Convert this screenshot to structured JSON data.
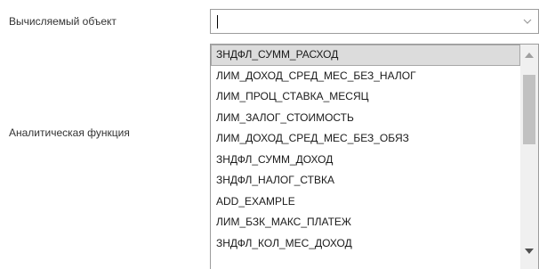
{
  "form": {
    "object_label": "Вычисляемый объект",
    "function_label": "Аналитическая функция",
    "object_value": ""
  },
  "dropdown": {
    "items": [
      "ЗНДФЛ_СУММ_РАСХОД",
      "ЛИМ_ДОХОД_СРЕД_МЕС_БЕЗ_НАЛОГ",
      "ЛИМ_ПРОЦ_СТАВКА_МЕСЯЦ",
      "ЛИМ_ЗАЛОГ_СТОИМОСТЬ",
      "ЛИМ_ДОХОД_СРЕД_МЕС_БЕЗ_ОБЯЗ",
      "ЗНДФЛ_СУММ_ДОХОД",
      "ЗНДФЛ_НАЛОГ_СТВКА",
      "ADD_EXAMPLE",
      "ЛИМ_БЗК_МАКС_ПЛАТЕЖ",
      "ЗНДФЛ_КОЛ_МЕС_ДОХОД"
    ],
    "selected_index": 0
  },
  "icons": {
    "combo_arrow": "chevron-down-icon",
    "scroll_up": "triangle-up-icon",
    "scroll_down": "triangle-down-icon"
  },
  "colors": {
    "border": "#9c9c9c",
    "selected_bg": "#dcdcdc",
    "scroll_track": "#f0f0f0",
    "scroll_thumb": "#c1c1c1"
  }
}
